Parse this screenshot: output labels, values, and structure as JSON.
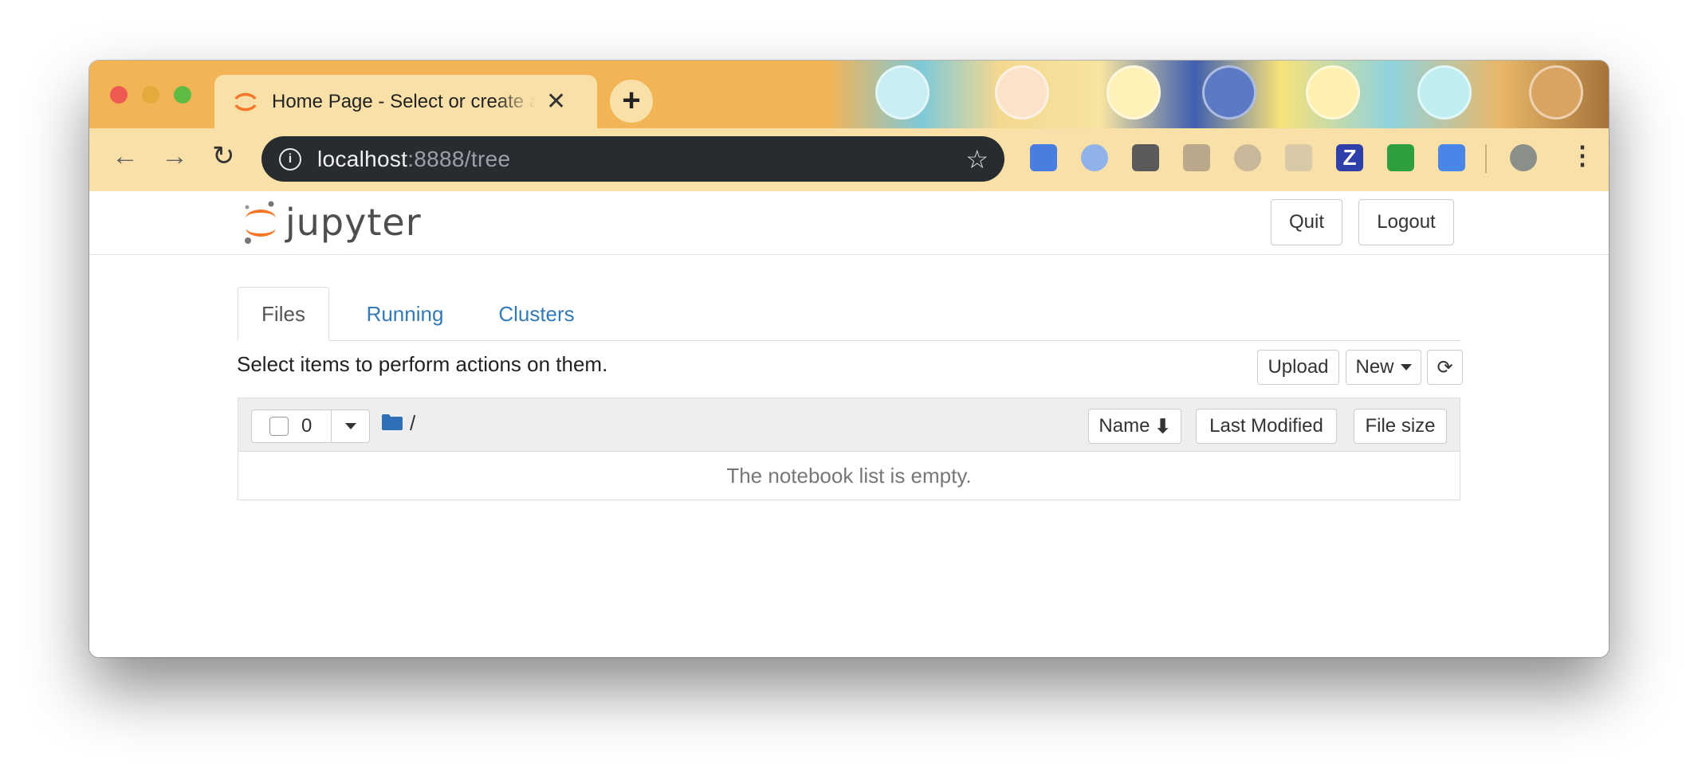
{
  "browser": {
    "tab_title": "Home Page - Select or create a notebook",
    "tab_close": "✕",
    "new_tab": "+",
    "url_host": "localhost",
    "url_path": ":8888/tree",
    "back_icon": "←",
    "forward_icon": "→",
    "reload_icon": "↻",
    "star_icon": "☆",
    "menu_icon": "⋮",
    "info_icon": "i"
  },
  "jupyter": {
    "logo_text": "jupyter",
    "quit_label": "Quit",
    "logout_label": "Logout",
    "tabs": [
      {
        "label": "Files"
      },
      {
        "label": "Running"
      },
      {
        "label": "Clusters"
      }
    ],
    "hint": "Select items to perform actions on them.",
    "upload_label": "Upload",
    "new_label": "New",
    "refresh_icon": "⟳",
    "selected_count": "0",
    "breadcrumb": "/",
    "sort_name_label": "Name",
    "sort_name_arrow": "🡇",
    "last_modified_label": "Last Modified",
    "file_size_label": "File size",
    "empty_message": "The notebook list is empty."
  },
  "colors": {
    "link": "#337ab7",
    "jupyter_orange": "#f37726",
    "folder": "#2f6fb5"
  }
}
